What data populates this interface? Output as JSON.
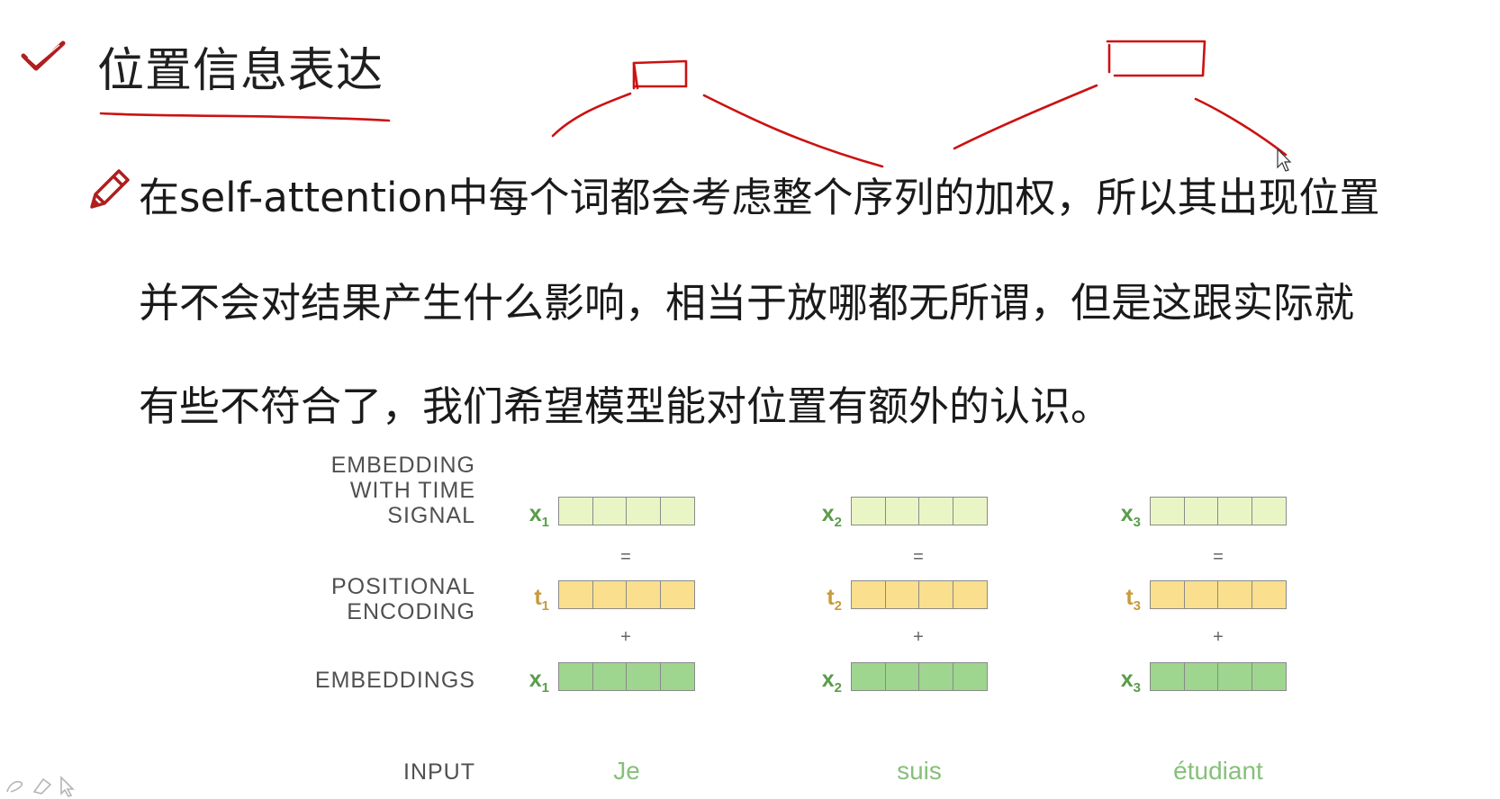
{
  "slide": {
    "title": "位置信息表达",
    "paragraph_lines": [
      "在self-attention中每个词都会考虑整个序列的加权，所以其出现位置",
      "并不会对结果产生什么影响，相当于放哪都无所谓，但是这跟实际就",
      "有些不符合了，我们希望模型能对位置有额外的认识。"
    ]
  },
  "figure": {
    "row_labels": {
      "signal": "EMBEDDING\nWITH TIME\nSIGNAL",
      "positional": "POSITIONAL\nENCODING",
      "embeddings": "EMBEDDINGS",
      "input": "INPUT"
    },
    "operators": {
      "equals": "=",
      "plus": "+"
    },
    "columns": [
      {
        "x_var": "x",
        "t_var": "t",
        "index": "1",
        "word": "Je"
      },
      {
        "x_var": "x",
        "t_var": "t",
        "index": "2",
        "word": "suis"
      },
      {
        "x_var": "x",
        "t_var": "t",
        "index": "3",
        "word": "étudiant"
      }
    ],
    "colors": {
      "signal_fill": "#eaf5c6",
      "positional_fill": "#f9df8e",
      "embedding_fill": "#9ed58f",
      "x_label": "#5a9c4a",
      "t_label": "#c79a3a",
      "word": "#86c07a"
    }
  },
  "icons": {
    "header": "check-icon",
    "bullet": "pencil-icon",
    "annotation": "pen-annotation",
    "tools": [
      "pen-tool-icon",
      "eraser-tool-icon",
      "pointer-tool-icon"
    ]
  },
  "annotation_color": "#cc1111"
}
